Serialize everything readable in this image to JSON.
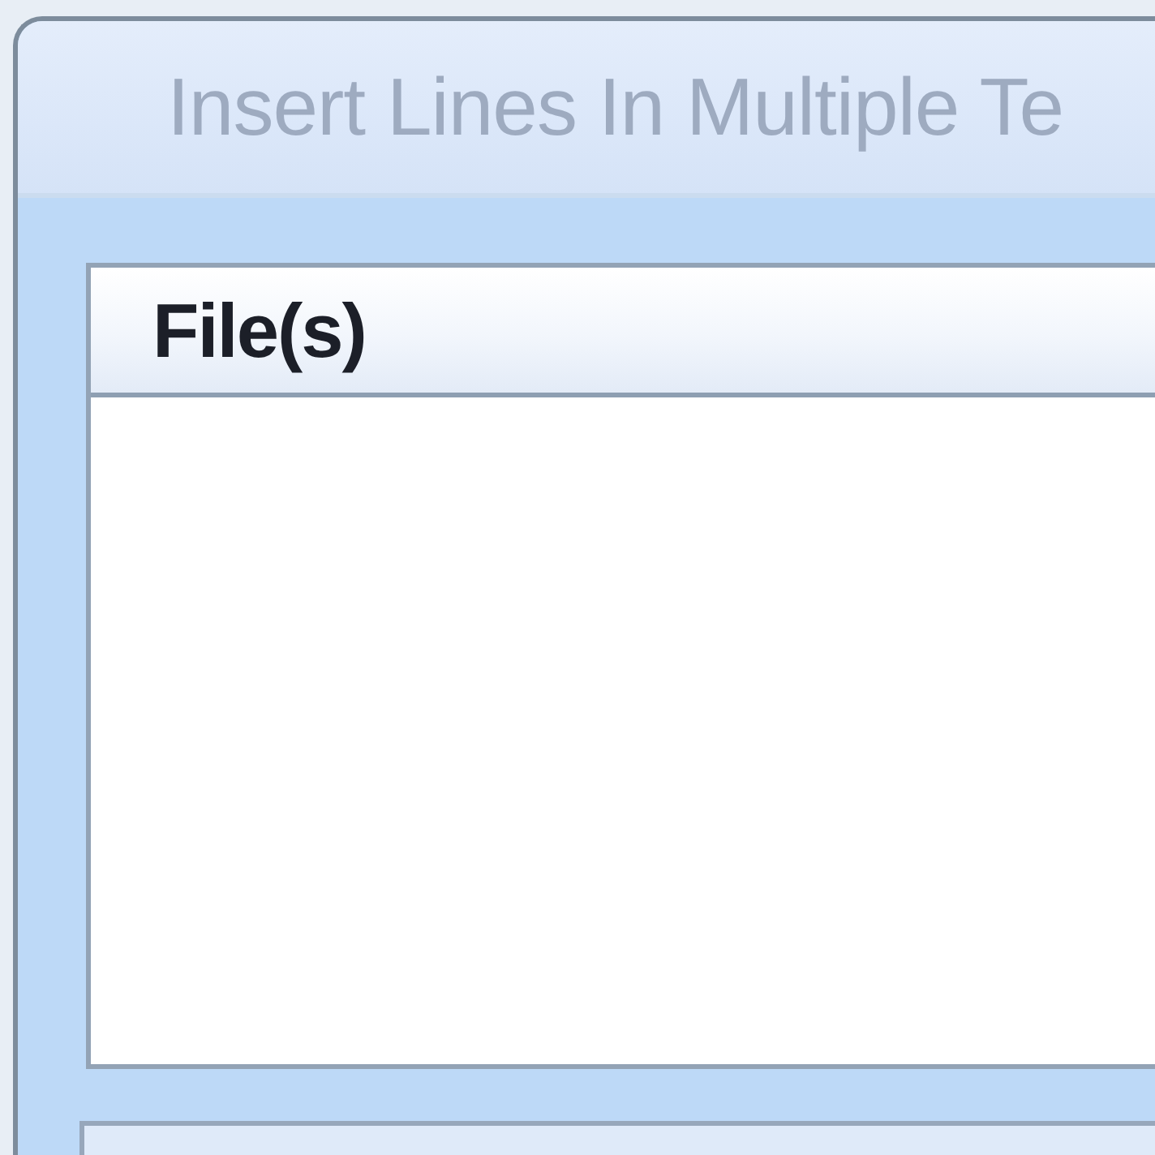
{
  "window": {
    "title": "Insert Lines In Multiple Te"
  },
  "file_list": {
    "columns": [
      {
        "label": "File(s)"
      }
    ]
  }
}
